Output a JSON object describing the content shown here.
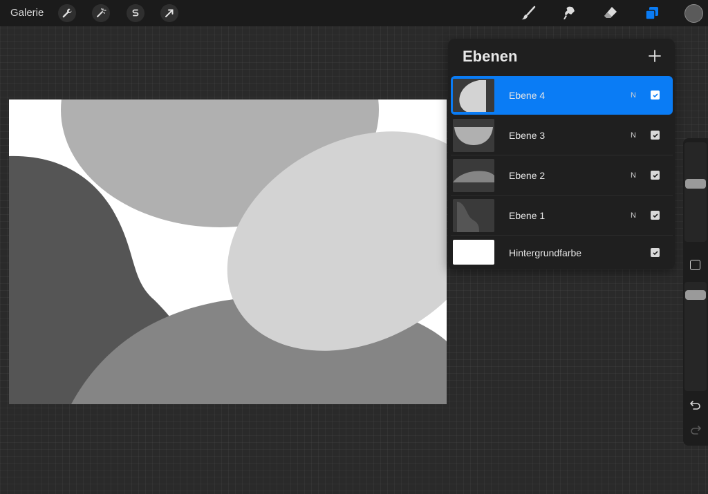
{
  "topbar": {
    "gallery_label": "Galerie",
    "left_tools": [
      "wrench-icon",
      "magic-wand-icon",
      "selection-s-icon",
      "transform-arrow-icon"
    ],
    "right_tools": [
      "brush-icon",
      "smudge-icon",
      "eraser-icon",
      "layers-icon"
    ],
    "active_tool": "layers-icon",
    "current_color": "#5a5a5a",
    "accent": "#0a7cf5"
  },
  "layers": {
    "title": "Ebenen",
    "add_icon": "plus-icon",
    "items": [
      {
        "name": "Ebene 4",
        "blend": "N",
        "visible": true,
        "active": true
      },
      {
        "name": "Ebene 3",
        "blend": "N",
        "visible": true,
        "active": false
      },
      {
        "name": "Ebene 2",
        "blend": "N",
        "visible": true,
        "active": false
      },
      {
        "name": "Ebene 1",
        "blend": "N",
        "visible": true,
        "active": false
      },
      {
        "name": "Hintergrundfarbe",
        "blend": "",
        "visible": true,
        "active": false
      }
    ]
  },
  "sidebar": {
    "brush_size_icon": "slider-handle",
    "opacity_icon": "slider-handle",
    "modify_icon": "square-icon",
    "undo_icon": "undo-icon",
    "redo_icon": "redo-icon"
  },
  "canvas": {
    "background_color": "#ffffff",
    "shape_colors": [
      "#b0b0b0",
      "#555555",
      "#858585",
      "#d3d3d3"
    ]
  }
}
